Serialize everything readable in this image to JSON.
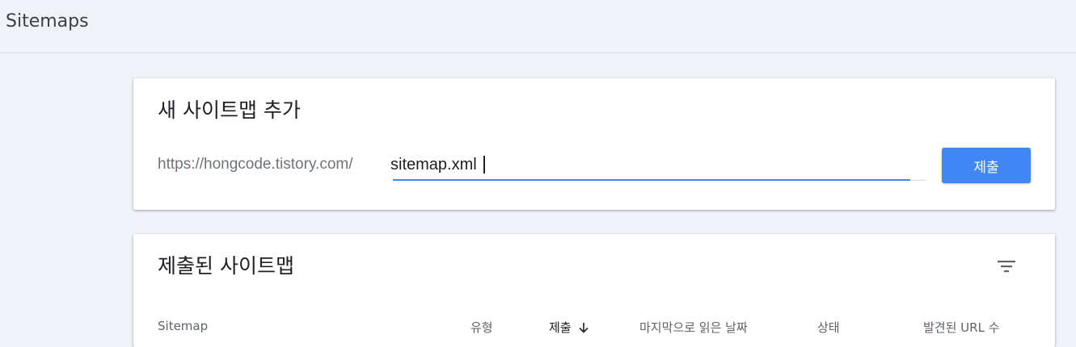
{
  "page": {
    "title": "Sitemaps"
  },
  "add_sitemap": {
    "title": "새 사이트맵 추가",
    "url_prefix": "https://hongcode.tistory.com/",
    "input_value": "sitemap.xml",
    "submit_label": "제출"
  },
  "submitted_sitemaps": {
    "title": "제출된 사이트맵",
    "filter_icon": "filter-icon",
    "columns": {
      "sitemap": "Sitemap",
      "type": "유형",
      "submitted": "제출",
      "last_read": "마지막으로 읽은 날짜",
      "status": "상태",
      "discovered_urls": "발견된 URL 수"
    },
    "sort_icon": "arrow-down-icon"
  },
  "colors": {
    "background": "#f1f3fa",
    "accent": "#4285f4",
    "card": "#ffffff"
  }
}
